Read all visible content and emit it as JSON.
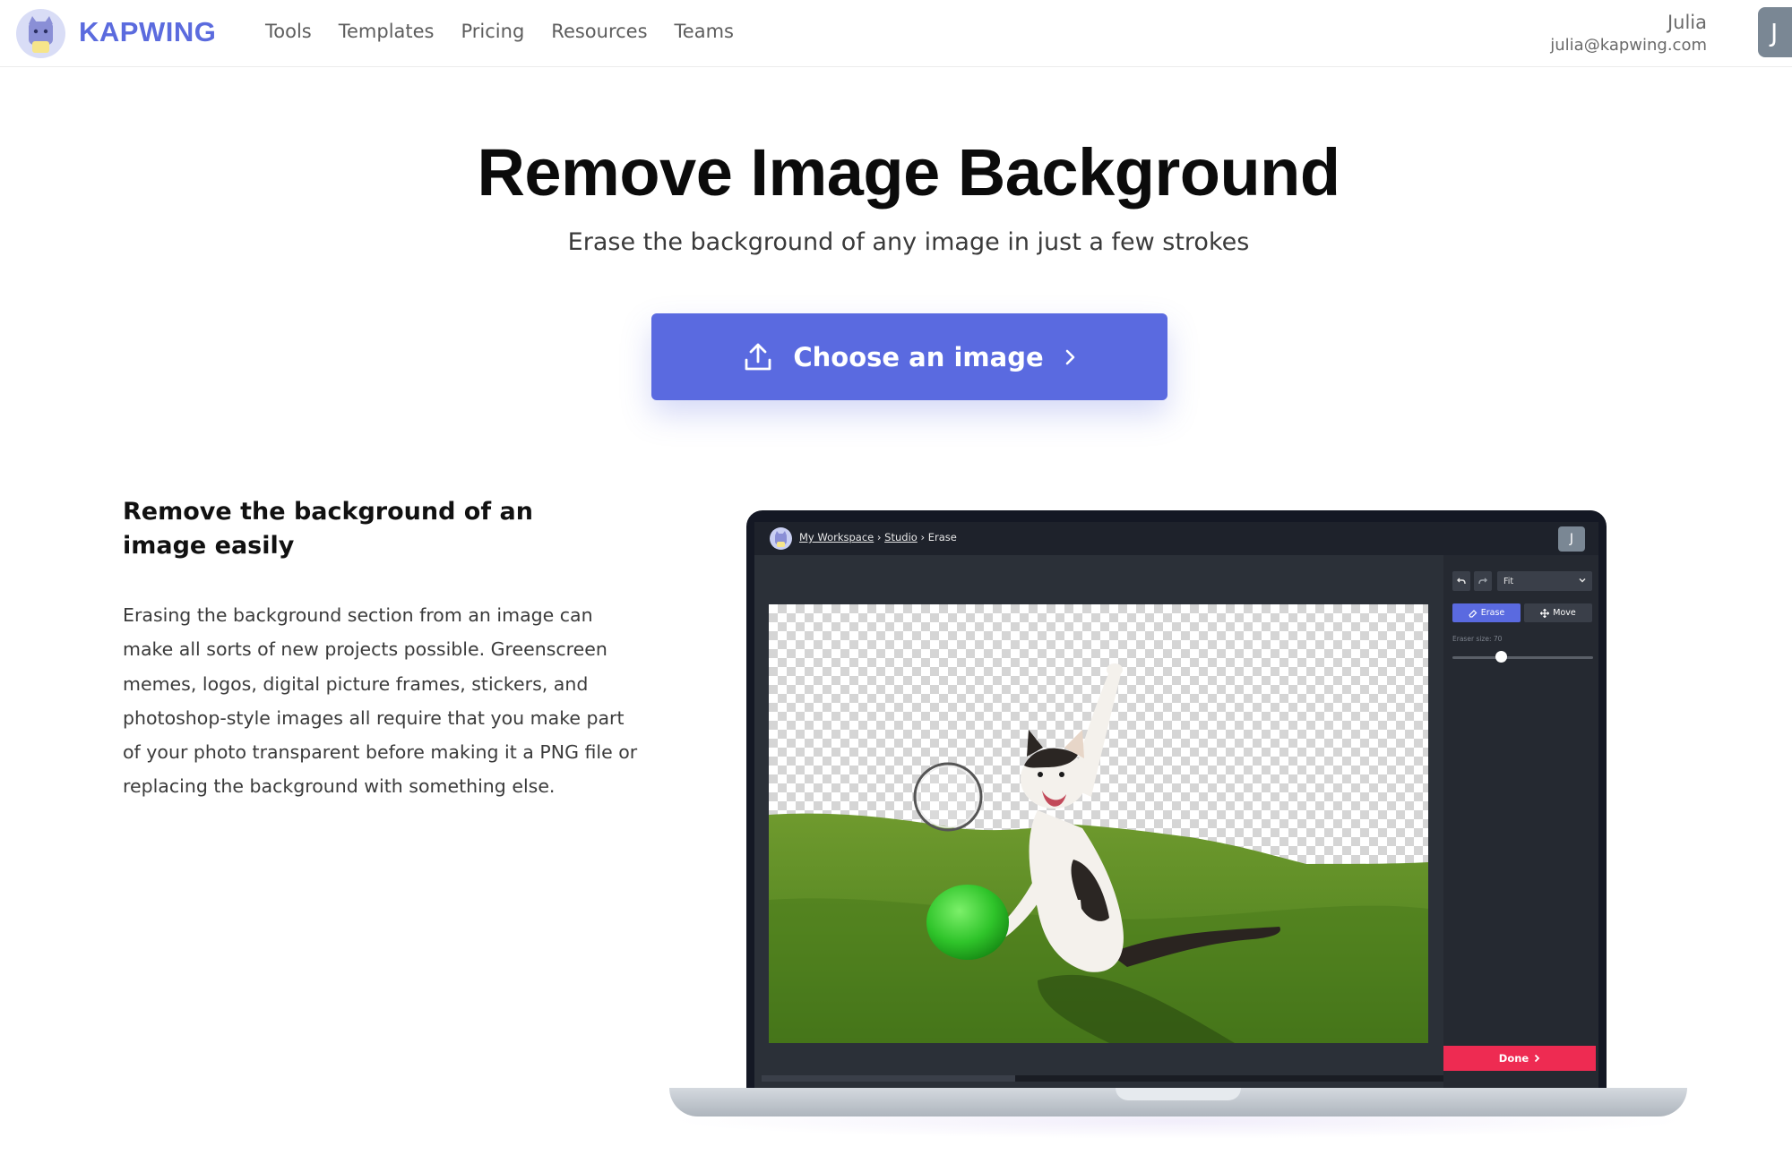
{
  "brand": {
    "name": "KAPWING",
    "color": "#5b6bde"
  },
  "nav": {
    "links": [
      "Tools",
      "Templates",
      "Pricing",
      "Resources",
      "Teams"
    ]
  },
  "user": {
    "name": "Julia",
    "email": "julia@kapwing.com",
    "initial": "J"
  },
  "hero": {
    "title": "Remove Image Background",
    "subtitle": "Erase the background of any image in just a few strokes",
    "cta_label": "Choose an image",
    "cta_icon": "upload-icon",
    "cta_color": "#5a6ae0"
  },
  "feature": {
    "title": "Remove the background of an image easily",
    "body": "Erasing the background section from an image can make all sorts of new projects possible. Greenscreen memes, logos, digital picture frames, stickers, and photoshop-style images all require that you make part of your photo transparent before making it a PNG file or replacing the background with something else."
  },
  "mockup": {
    "breadcrumb": {
      "workspace": "My Workspace",
      "sep1": " › ",
      "studio": "Studio",
      "sep2": " › ",
      "current": "Erase"
    },
    "avatar_initial": "J",
    "zoom_select": "Fit",
    "undo_icon": "undo-icon",
    "redo_icon": "redo-icon",
    "modes": {
      "erase": "Erase",
      "move": "Move",
      "active": "erase"
    },
    "eraser_size_label": "Eraser size: 70",
    "eraser_size_fraction": 0.35,
    "done_label": "Done",
    "done_color": "#ee2b52"
  }
}
